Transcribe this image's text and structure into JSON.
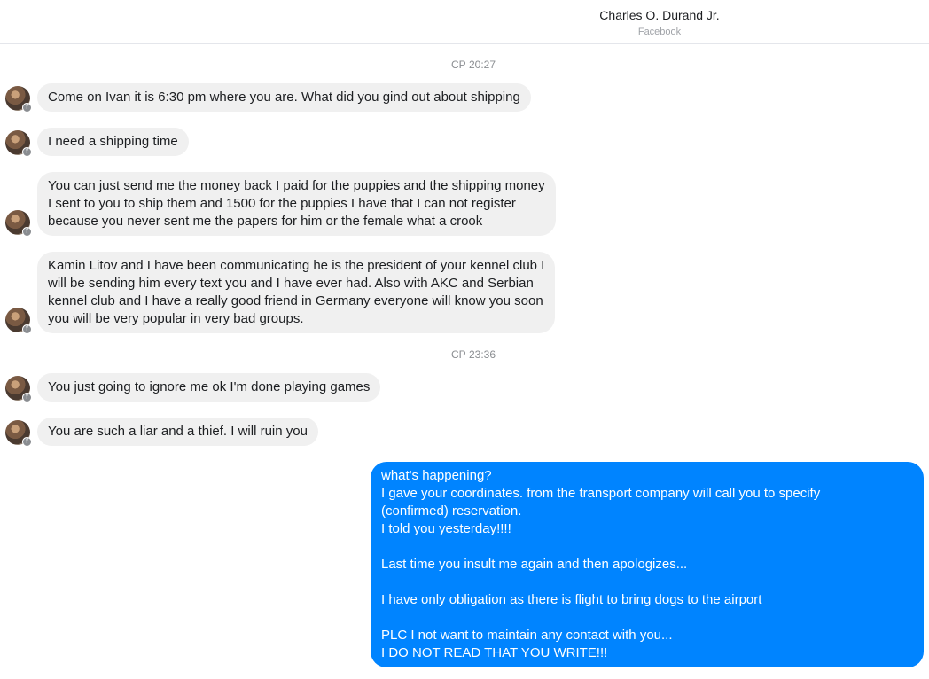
{
  "header": {
    "contact_name": "Charles O. Durand Jr.",
    "source": "Facebook"
  },
  "timestamps": [
    "СР 20:27",
    "СР 23:36"
  ],
  "incoming_messages": [
    "Come on Ivan it is 6:30 pm where you are. What did you gind out about shipping",
    "I need a shipping time",
    "You can just send me the money back I paid for the puppies and the shipping money\nI sent to you to ship them and 1500 for the puppies I have that I can not register\nbecause you never sent me the papers for him or the female what a crook",
    "Kamin Litov and I have been communicating he is the president of your kennel club I\nwill be sending him every text you and I have ever had. Also with AKC and Serbian\nkennel club and I have a really good friend in Germany everyone will know you soon\nyou will be very popular in very bad groups.",
    "You just going to ignore me ok I'm done playing games",
    "You are such a liar and a thief. I will ruin you"
  ],
  "outgoing_message": "what's happening?\nI gave your coordinates. from the transport company will call you to specify\n(confirmed) reservation.\nI told you yesterday!!!!\n\nLast time you insult me again and then apologizes...\n\nI have only obligation as there is flight to bring dogs to the airport\n\nPLC I not want to maintain any contact with you...\nI DO NOT READ THAT YOU WRITE!!!",
  "colors": {
    "incoming_bubble": "#f0f0f0",
    "outgoing_bubble": "#0084ff"
  }
}
